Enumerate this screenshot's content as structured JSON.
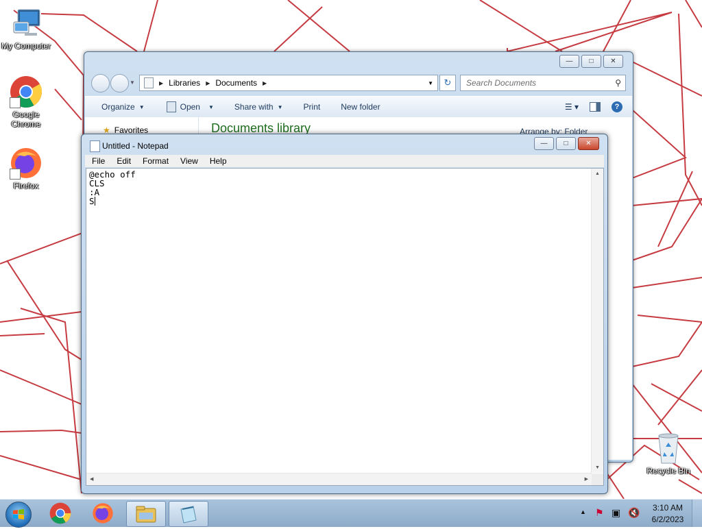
{
  "desktop": {
    "icons": [
      {
        "label": "My Computer",
        "icon": "computer-icon"
      },
      {
        "label": "Google Chrome",
        "icon": "chrome-icon"
      },
      {
        "label": "Firefox",
        "icon": "firefox-icon"
      },
      {
        "label": "Recycle Bin",
        "icon": "recycle-bin-icon"
      }
    ]
  },
  "explorer": {
    "breadcrumb": [
      "Libraries",
      "Documents"
    ],
    "search_placeholder": "Search Documents",
    "toolbar": {
      "organize": "Organize",
      "open": "Open",
      "share_with": "Share with",
      "print": "Print",
      "new_folder": "New folder"
    },
    "nav": {
      "favorites": "Favorites"
    },
    "library_title": "Documents library",
    "arrange_label": "Arrange by: Folder"
  },
  "notepad": {
    "title": "Untitled - Notepad",
    "menu": [
      "File",
      "Edit",
      "Format",
      "View",
      "Help"
    ],
    "content": "@echo off\nCLS\n:A\nS"
  },
  "taskbar": {
    "apps": [
      "Google Chrome",
      "Firefox",
      "Windows Explorer",
      "Notepad"
    ],
    "clock": {
      "time": "3:10 AM",
      "date": "6/2/2023"
    }
  },
  "colors": {
    "wallpaper_lines": "#c0262d",
    "library_title": "#1f6e1f",
    "taskbar": "#9fbbd7"
  }
}
